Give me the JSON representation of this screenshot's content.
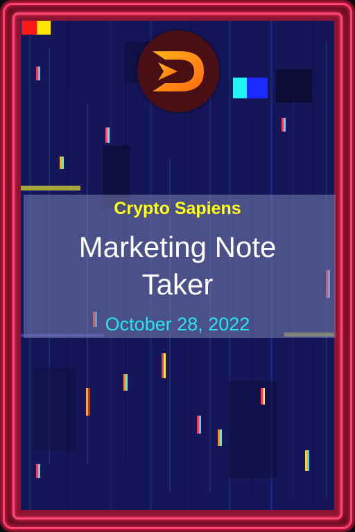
{
  "card": {
    "brand": "Crypto Sapiens",
    "title": "Marketing Note Taker",
    "date": "October 28, 2022"
  },
  "logo": {
    "icon": "d-play-logo-icon"
  },
  "colors": {
    "brand_text": "#ffff1a",
    "title_text": "#ffffff",
    "date_text": "#27e6f0",
    "frame_neon": "#ff3f6e",
    "background": "#15155a"
  }
}
